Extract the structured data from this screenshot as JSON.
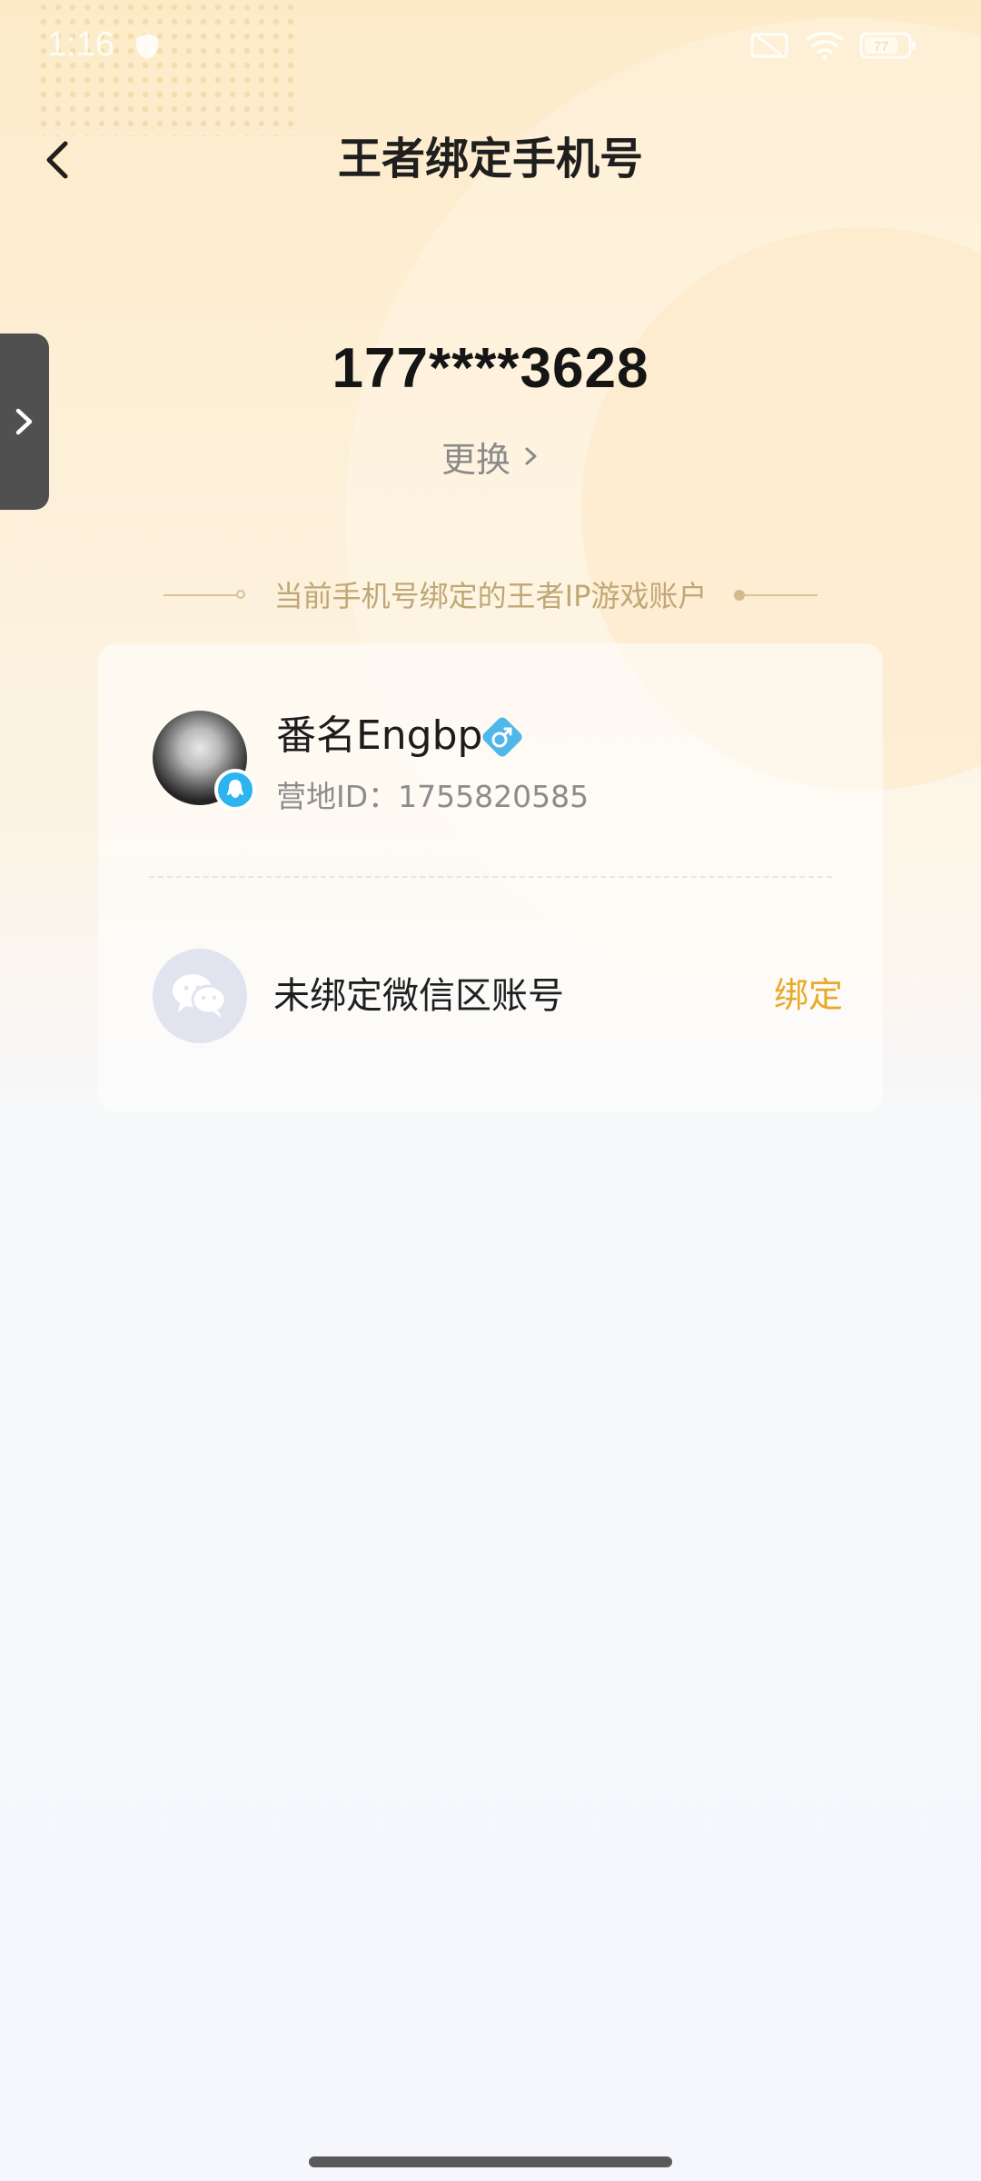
{
  "status_bar": {
    "time": "1:16",
    "icons": [
      "shield-icon",
      "notification-off-icon",
      "wifi-icon",
      "battery-icon"
    ],
    "battery_text": "77"
  },
  "header": {
    "title": "王者绑定手机号",
    "back_icon": "chevron-left-icon"
  },
  "side_tab": {
    "icon": "chevron-right-icon"
  },
  "phone": {
    "number": "177****3628",
    "change_label": "更换",
    "change_icon": "chevron-right-icon"
  },
  "section": {
    "caption": "当前手机号绑定的王者IP游戏账户"
  },
  "accounts": {
    "qq": {
      "nickname": "番名Engbp",
      "camp_id": "营地ID：1755820585",
      "badge_icon": "qq-icon",
      "gender_icon": "male-icon"
    },
    "wechat": {
      "status_text": "未绑定微信区账号",
      "bind_label": "绑定",
      "icon": "wechat-icon"
    }
  },
  "colors": {
    "accent": "#e9a92a",
    "qq_blue": "#2db4ee",
    "gender_blue": "#4fb8e8",
    "caption": "#c0a876"
  }
}
